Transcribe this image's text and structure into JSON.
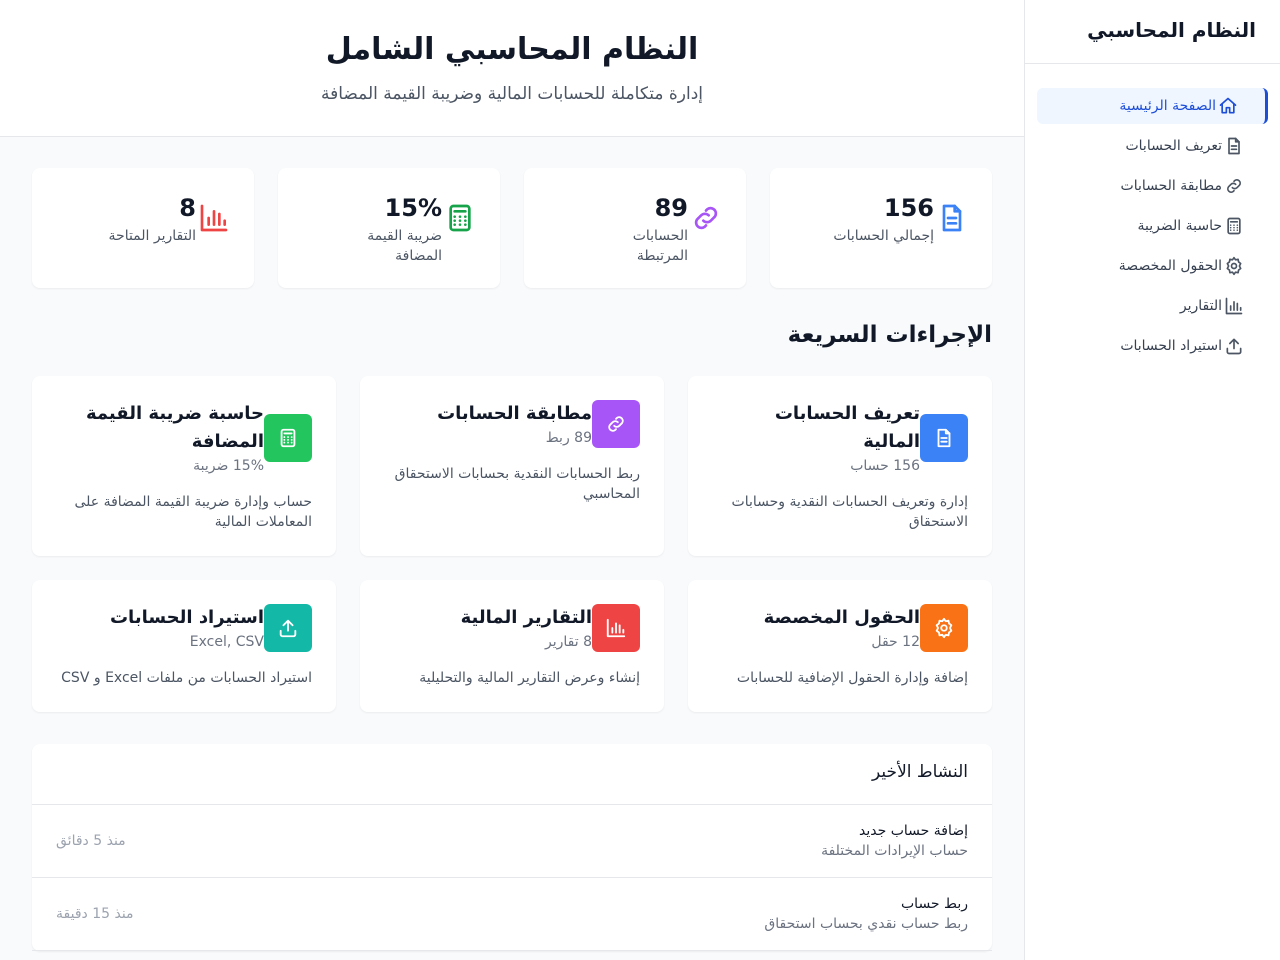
{
  "colors": {
    "primary": "#1d4ed8",
    "blue": "#3b82f6",
    "purple": "#a855f7",
    "green": "#22c55e",
    "orange": "#f97316",
    "red": "#ef4444",
    "teal": "#14b8a6"
  },
  "sidebar": {
    "title": "النظام المحاسبي",
    "items": [
      {
        "label": "الصفحة الرئيسية",
        "icon": "home-icon",
        "active": true
      },
      {
        "label": "تعريف الحسابات",
        "icon": "document-icon"
      },
      {
        "label": "مطابقة الحسابات",
        "icon": "link-icon"
      },
      {
        "label": "حاسبة الضريبة",
        "icon": "calculator-icon"
      },
      {
        "label": "الحقول المخصصة",
        "icon": "gear-icon"
      },
      {
        "label": "التقارير",
        "icon": "chart-icon"
      },
      {
        "label": "استيراد الحسابات",
        "icon": "upload-icon"
      }
    ]
  },
  "hero": {
    "title": "النظام المحاسبي الشامل",
    "subtitle": "إدارة متكاملة للحسابات المالية وضريبة القيمة المضافة"
  },
  "stats": [
    {
      "value": "156",
      "label": "إجمالي الحسابات",
      "icon": "document-icon"
    },
    {
      "value": "89",
      "label": "الحسابات المرتبطة",
      "icon": "link-icon"
    },
    {
      "value": "15%",
      "label": "ضريبة القيمة المضافة",
      "icon": "calculator-icon"
    },
    {
      "value": "8",
      "label": "التقارير المتاحة",
      "icon": "chart-icon"
    }
  ],
  "quick_actions": {
    "title": "الإجراءات السريعة",
    "cards": [
      {
        "title": "تعريف الحسابات المالية",
        "sub": "156 حساب",
        "desc": "إدارة وتعريف الحسابات النقدية وحسابات الاستحقاق",
        "icon": "document-icon"
      },
      {
        "title": "مطابقة الحسابات",
        "sub": "89 ربط",
        "desc": "ربط الحسابات النقدية بحسابات الاستحقاق المحاسبي",
        "icon": "link-icon"
      },
      {
        "title": "حاسبة ضريبة القيمة المضافة",
        "sub": "15% ضريبة",
        "desc": "حساب وإدارة ضريبة القيمة المضافة على المعاملات المالية",
        "icon": "calculator-icon"
      },
      {
        "title": "الحقول المخصصة",
        "sub": "12 حقل",
        "desc": "إضافة وإدارة الحقول الإضافية للحسابات",
        "icon": "gear-icon"
      },
      {
        "title": "التقارير المالية",
        "sub": "8 تقارير",
        "desc": "إنشاء وعرض التقارير المالية والتحليلية",
        "icon": "chart-icon"
      },
      {
        "title": "استيراد الحسابات",
        "sub": "Excel, CSV",
        "desc": "استيراد الحسابات من ملفات Excel و CSV",
        "icon": "upload-icon"
      }
    ]
  },
  "activity": {
    "title": "النشاط الأخير",
    "rows": [
      {
        "title": "إضافة حساب جديد",
        "desc": "حساب الإيرادات المختلفة",
        "time": "منذ 5 دقائق"
      },
      {
        "title": "ربط حساب",
        "desc": "ربط حساب نقدي بحساب استحقاق",
        "time": "منذ 15 دقيقة"
      }
    ]
  }
}
